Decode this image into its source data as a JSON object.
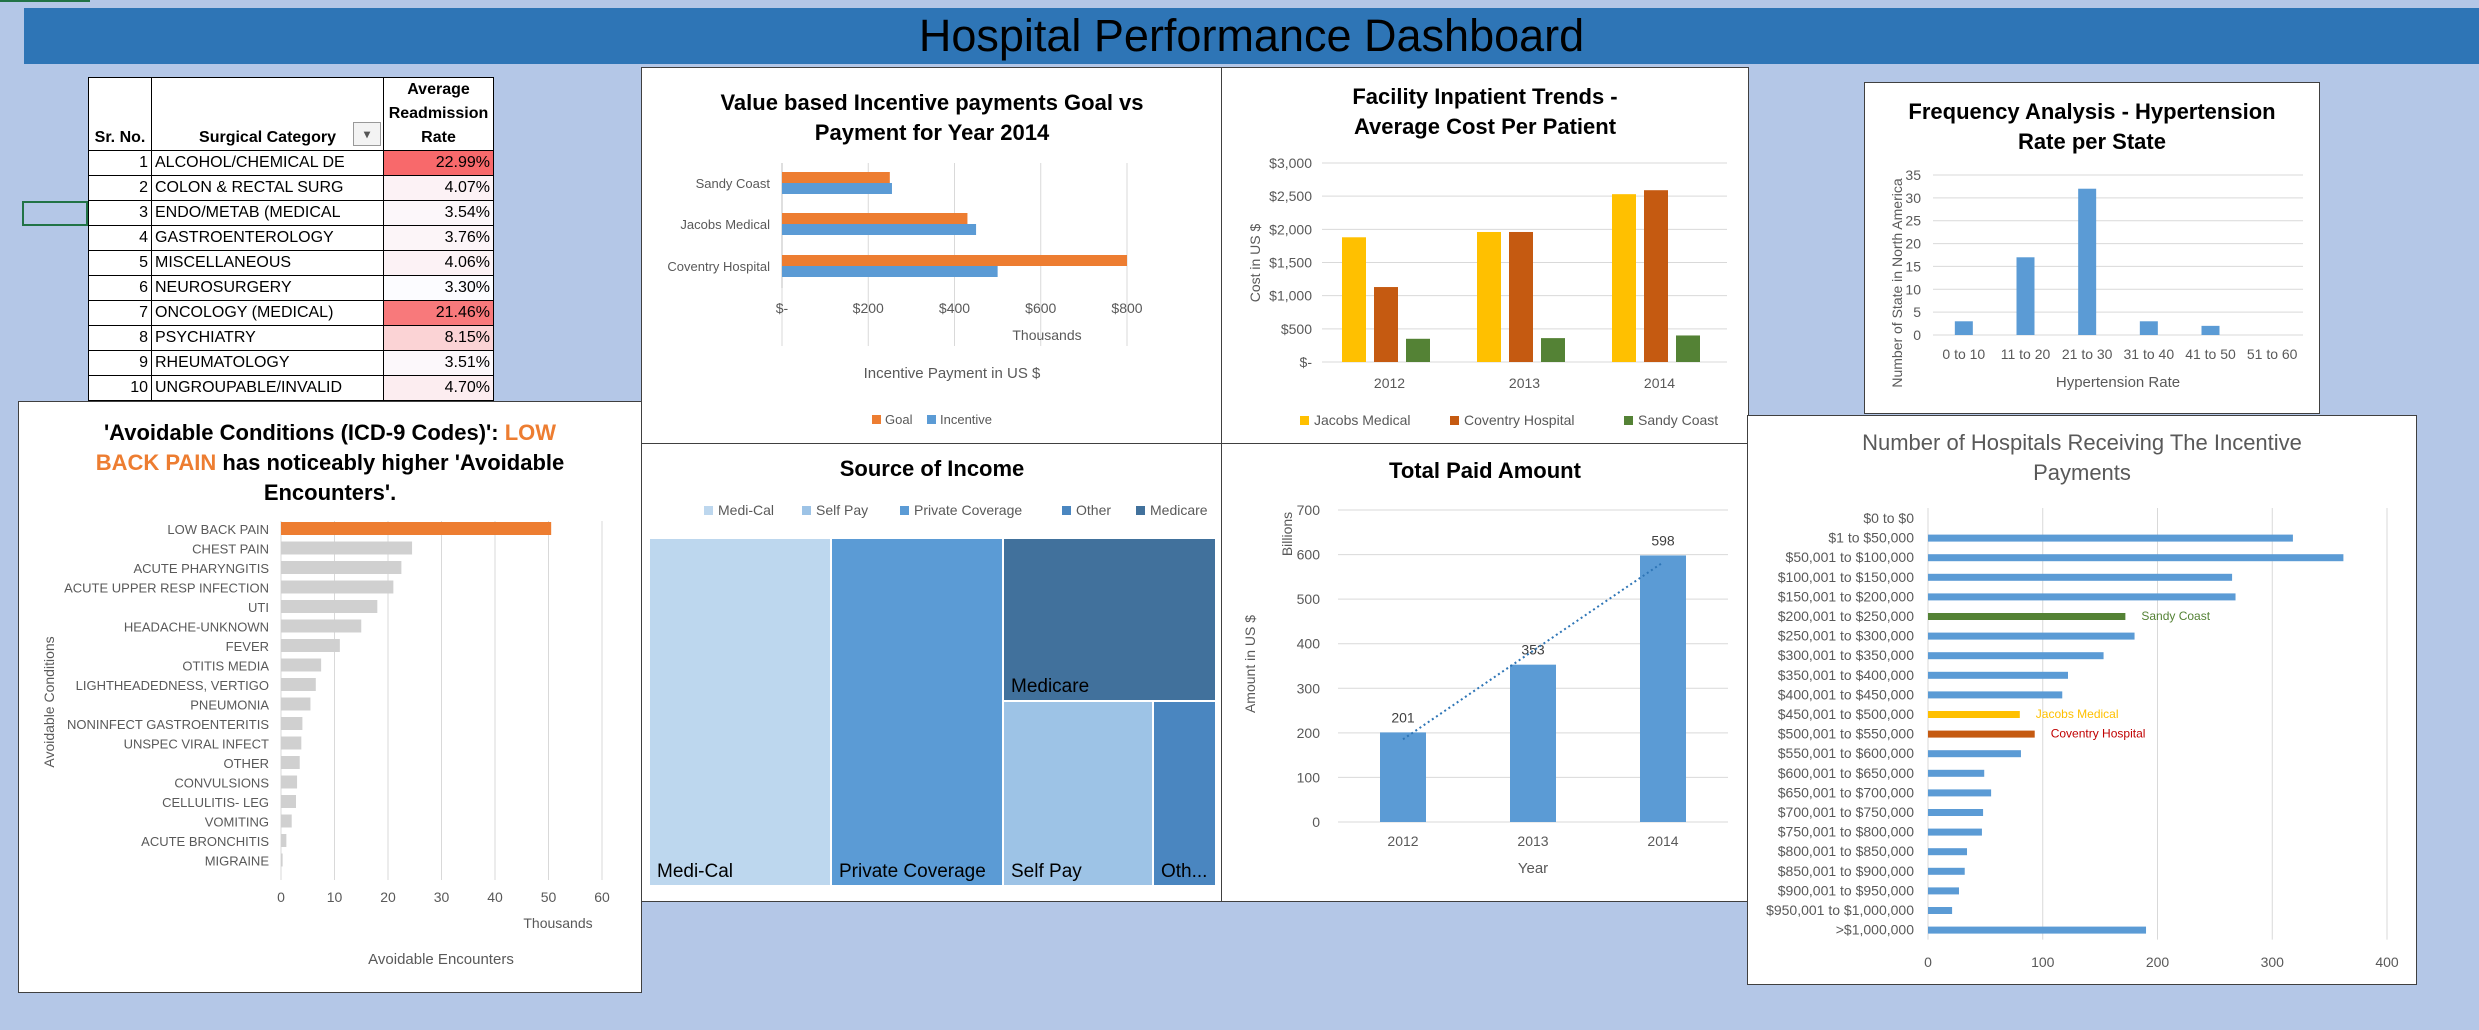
{
  "dashboard": {
    "title": "Hospital Performance Dashboard"
  },
  "readmission_table": {
    "headers": {
      "sr": "Sr. No.",
      "category": "Surgical Category",
      "rate_l1": "Average",
      "rate_l2": "Readmission",
      "rate_l3": "Rate"
    },
    "rows": [
      {
        "sr": "1",
        "category": "ALCOHOL/CHEMICAL DE",
        "rate": "22.99%",
        "color": "#f8696b"
      },
      {
        "sr": "2",
        "category": "COLON & RECTAL SURG",
        "rate": "4.07%",
        "color": "#fcf2f5"
      },
      {
        "sr": "3",
        "category": "ENDO/METAB (MEDICAL",
        "rate": "3.54%",
        "color": "#fcf7fa"
      },
      {
        "sr": "4",
        "category": "GASTROENTEROLOGY",
        "rate": "3.76%",
        "color": "#fcf5f8"
      },
      {
        "sr": "5",
        "category": "MISCELLANEOUS",
        "rate": "4.06%",
        "color": "#fcf2f5"
      },
      {
        "sr": "6",
        "category": "NEUROSURGERY",
        "rate": "3.30%",
        "color": "#fcfcff"
      },
      {
        "sr": "7",
        "category": "ONCOLOGY (MEDICAL)",
        "rate": "21.46%",
        "color": "#f8797b"
      },
      {
        "sr": "8",
        "category": "PSYCHIATRY",
        "rate": "8.15%",
        "color": "#fbd3d5"
      },
      {
        "sr": "9",
        "category": "RHEUMATOLOGY",
        "rate": "3.51%",
        "color": "#fcf8fb"
      },
      {
        "sr": "10",
        "category": "UNGROUPABLE/INVALID",
        "rate": "4.70%",
        "color": "#fcedf0"
      }
    ]
  },
  "chart_data": [
    {
      "id": "incentive",
      "type": "bar",
      "title_l1": "Value based Incentive payments Goal vs",
      "title_l2": "Payment for Year 2014",
      "categories": [
        "Sandy Coast",
        "Jacobs Medical",
        "Coventry Hospital"
      ],
      "series": [
        {
          "name": "Goal",
          "color": "#ed7d31",
          "values": [
            250,
            430,
            800
          ]
        },
        {
          "name": "Incentive",
          "color": "#5b9bd5",
          "values": [
            255,
            450,
            500
          ]
        }
      ],
      "xlim": [
        0,
        800
      ],
      "ticks": [
        "$-",
        "$200",
        "$400",
        "$600",
        "$800"
      ],
      "units_label": "Thousands",
      "xlabel": "Incentive Payment in US $",
      "legend": "bottom"
    },
    {
      "id": "inpatient",
      "type": "bar",
      "title_l1": "Facility Inpatient Trends -",
      "title_l2": "Average Cost Per Patient",
      "categories": [
        "2012",
        "2013",
        "2014"
      ],
      "series": [
        {
          "name": "Jacobs Medical",
          "color": "#ffc000",
          "values": [
            1880,
            1960,
            2530
          ]
        },
        {
          "name": "Coventry Hospital",
          "color": "#c55a11",
          "values": [
            1130,
            1960,
            2590
          ]
        },
        {
          "name": "Sandy Coast",
          "color": "#548235",
          "values": [
            350,
            360,
            400
          ]
        }
      ],
      "ylim": [
        0,
        3000
      ],
      "ticks": [
        "$-",
        "$500",
        "$1,000",
        "$1,500",
        "$2,000",
        "$2,500",
        "$3,000"
      ],
      "ylabel": "Cost in US $",
      "legend": "bottom"
    },
    {
      "id": "hypertension",
      "type": "bar",
      "title_l1": "Frequency Analysis - Hypertension",
      "title_l2": "Rate per State",
      "categories": [
        "0 to 10",
        "11 to 20",
        "21 to 30",
        "31 to 40",
        "41 to 50",
        "51 to 60"
      ],
      "values": [
        3,
        17,
        32,
        3,
        2,
        0
      ],
      "ylim": [
        0,
        35
      ],
      "ticks": [
        "0",
        "5",
        "10",
        "15",
        "20",
        "25",
        "30",
        "35"
      ],
      "xlabel": "Hypertension Rate",
      "ylabel": "Number of State in North America",
      "color": "#5b9bd5"
    },
    {
      "id": "avoidable",
      "type": "bar",
      "title_l1a": "'Avoidable Conditions (ICD-9 Codes)': ",
      "title_l1b": "LOW",
      "title_l2a": "BACK PAIN",
      "title_l2b": " has noticeably higher 'Avoidable",
      "title_l3": "Encounters'.",
      "categories": [
        "LOW BACK PAIN",
        "CHEST PAIN",
        "ACUTE PHARYNGITIS",
        "ACUTE UPPER RESP INFECTION",
        "UTI",
        "HEADACHE-UNKNOWN",
        "FEVER",
        "OTITIS MEDIA",
        "LIGHTHEADEDNESS, VERTIGO",
        "PNEUMONIA",
        "NONINFECT GASTROENTERITIS",
        "UNSPEC VIRAL INFECT",
        "OTHER",
        "CONVULSIONS",
        "CELLULITIS- LEG",
        "VOMITING",
        "ACUTE BRONCHITIS",
        "MIGRAINE"
      ],
      "values": [
        50.5,
        24.5,
        22.5,
        21,
        18,
        15,
        11,
        7.5,
        6.5,
        5.5,
        4,
        3.8,
        3.5,
        3,
        2.8,
        2,
        1,
        0.3
      ],
      "highlight_color": "#ed7d31",
      "color": "#d0d0d0",
      "xlim": [
        0,
        60
      ],
      "ticks": [
        "0",
        "10",
        "20",
        "30",
        "40",
        "50",
        "60"
      ],
      "units_label": "Thousands",
      "xlabel": "Avoidable Encounters",
      "ylabel": "Avoidable Conditions"
    },
    {
      "id": "income",
      "type": "treemap",
      "title": "Source of Income",
      "legend": [
        {
          "name": "Medi-Cal",
          "color": "#bdd7ee"
        },
        {
          "name": "Self Pay",
          "color": "#9dc3e6"
        },
        {
          "name": "Private Coverage",
          "color": "#5b9bd5"
        },
        {
          "name": "Other",
          "color": "#4a86c0"
        },
        {
          "name": "Medicare",
          "color": "#41719c"
        }
      ],
      "labels": {
        "medical": "Medi-Cal",
        "private": "Private Coverage",
        "medicare": "Medicare",
        "selfpay": "Self Pay",
        "other": "Oth..."
      }
    },
    {
      "id": "paid",
      "type": "bar",
      "title": "Total Paid Amount",
      "categories": [
        "2012",
        "2013",
        "2014"
      ],
      "values": [
        201,
        353,
        598
      ],
      "data_labels": [
        "201",
        "353",
        "598"
      ],
      "ylim": [
        0,
        700
      ],
      "ticks": [
        "0",
        "100",
        "200",
        "300",
        "400",
        "500",
        "600",
        "700"
      ],
      "units_label": "Billions",
      "ylabel": "Amount in US $",
      "xlabel": "Year",
      "trendline": "linear",
      "color": "#5b9bd5"
    },
    {
      "id": "hospitals",
      "type": "bar",
      "title_l1": "Number of Hospitals Receiving The Incentive",
      "title_l2": "Payments",
      "categories": [
        "$0 to $0",
        "$1 to $50,000",
        "$50,001 to $100,000",
        "$100,001 to $150,000",
        "$150,001 to $200,000",
        "$200,001 to $250,000",
        "$250,001 to $300,000",
        "$300,001 to $350,000",
        "$350,001 to $400,000",
        "$400,001 to $450,000",
        "$450,001 to $500,000",
        "$500,001 to $550,000",
        "$550,001 to $600,000",
        "$600,001 to $650,000",
        "$650,001 to $700,000",
        "$700,001 to $750,000",
        "$750,001 to $800,000",
        "$800,001 to $850,000",
        "$850,001 to $900,000",
        "$900,001 to $950,000",
        "$950,001 to $1,000,000",
        ">$1,000,000"
      ],
      "values": [
        0,
        318,
        362,
        265,
        268,
        172,
        180,
        153,
        122,
        117,
        80,
        93,
        81,
        49,
        55,
        48,
        47,
        34,
        32,
        27,
        21,
        190
      ],
      "highlights": [
        {
          "index": 5,
          "name": "Sandy Coast",
          "color": "#548235"
        },
        {
          "index": 10,
          "name": "Jacobs Medical",
          "color": "#ffc000"
        },
        {
          "index": 11,
          "name": "Coventry Hospital",
          "color": "#c55a11"
        }
      ],
      "color": "#5b9bd5",
      "xlim": [
        0,
        400
      ],
      "ticks": [
        "0",
        "100",
        "200",
        "300",
        "400"
      ]
    }
  ]
}
